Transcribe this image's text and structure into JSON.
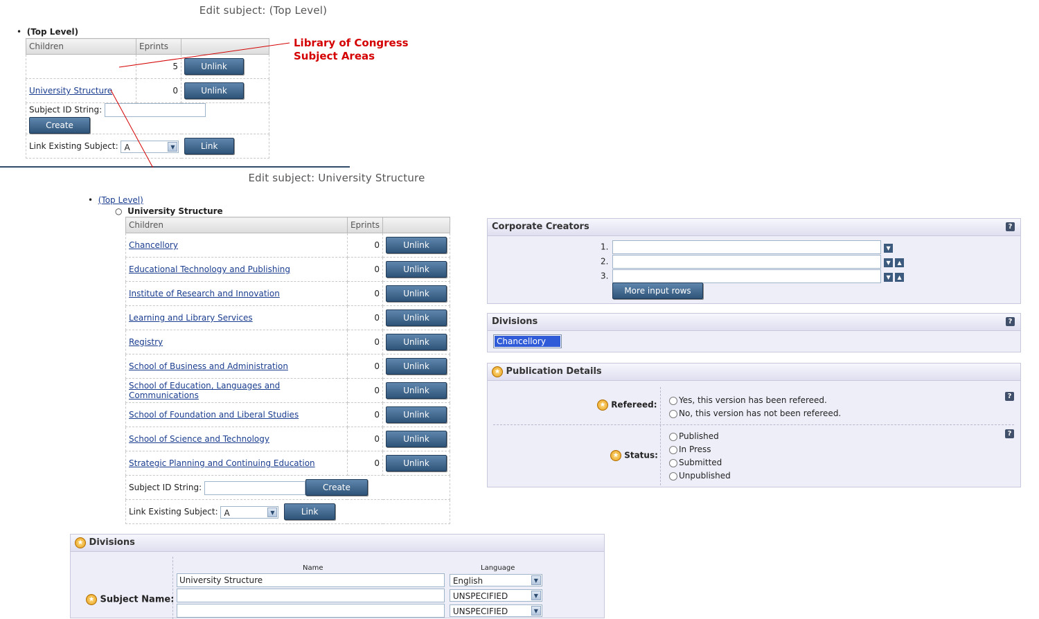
{
  "top": {
    "title": "Edit subject: (Top Level)",
    "crumb": "(Top Level)",
    "col_children": "Children",
    "col_eprints": "Eprints",
    "rows": [
      {
        "name": "",
        "count": "5",
        "action": "Unlink"
      },
      {
        "name": "University Structure",
        "count": "0",
        "action": "Unlink"
      }
    ],
    "subject_id_label": "Subject ID String:",
    "create_label": "Create",
    "link_existing_label": "Link Existing Subject:",
    "link_select_value": "A",
    "link_label": "Link"
  },
  "annotation": {
    "text": "Library of Congress Subject Areas",
    "color": "#d40000"
  },
  "univ": {
    "title": "Edit subject: University Structure",
    "crumb_top": "(Top Level)",
    "crumb_current": "University Structure",
    "col_children": "Children",
    "col_eprints": "Eprints",
    "rows": [
      {
        "name": "Chancellory",
        "count": "0",
        "action": "Unlink"
      },
      {
        "name": "Educational Technology and Publishing",
        "count": "0",
        "action": "Unlink"
      },
      {
        "name": "Institute of Research and Innovation",
        "count": "0",
        "action": "Unlink"
      },
      {
        "name": "Learning and Library Services",
        "count": "0",
        "action": "Unlink"
      },
      {
        "name": "Registry",
        "count": "0",
        "action": "Unlink"
      },
      {
        "name": "School of Business and Administration",
        "count": "0",
        "action": "Unlink"
      },
      {
        "name": "School of Education, Languages and Communications",
        "count": "0",
        "action": "Unlink"
      },
      {
        "name": "School of Foundation and Liberal Studies",
        "count": "0",
        "action": "Unlink"
      },
      {
        "name": "School of Science and Technology",
        "count": "0",
        "action": "Unlink"
      },
      {
        "name": "Strategic Planning and Continuing Education",
        "count": "0",
        "action": "Unlink"
      }
    ],
    "subject_id_label": "Subject ID String:",
    "create_label": "Create",
    "link_existing_label": "Link Existing Subject:",
    "link_select_value": "A",
    "link_label": "Link"
  },
  "divisions_form": {
    "heading": "Divisions",
    "col_name": "Name",
    "col_language": "Language",
    "field_label": "Subject Name:",
    "rows": [
      {
        "name": "University Structure",
        "language": "English"
      },
      {
        "name": "",
        "language": "UNSPECIFIED"
      },
      {
        "name": "",
        "language": "UNSPECIFIED"
      }
    ]
  },
  "corporate": {
    "heading": "Corporate Creators",
    "rows": [
      "1.",
      "2.",
      "3."
    ],
    "more_label": "More input rows"
  },
  "divisions_panel": {
    "heading": "Divisions",
    "selected": "Chancellory"
  },
  "publication": {
    "heading": "Publication Details",
    "refereed_label": "Refereed:",
    "refereed_options": [
      "Yes, this version has been refereed.",
      "No, this version has not been refereed."
    ],
    "status_label": "Status:",
    "status_options": [
      "Published",
      "In Press",
      "Submitted",
      "Unpublished"
    ]
  },
  "icons": {
    "help": "help-icon",
    "star": "required-star-icon",
    "down": "move-down-icon",
    "up": "move-up-icon"
  },
  "colors": {
    "button": "#3d6389",
    "panel": "#eeeef9",
    "annotation": "#d40000"
  }
}
